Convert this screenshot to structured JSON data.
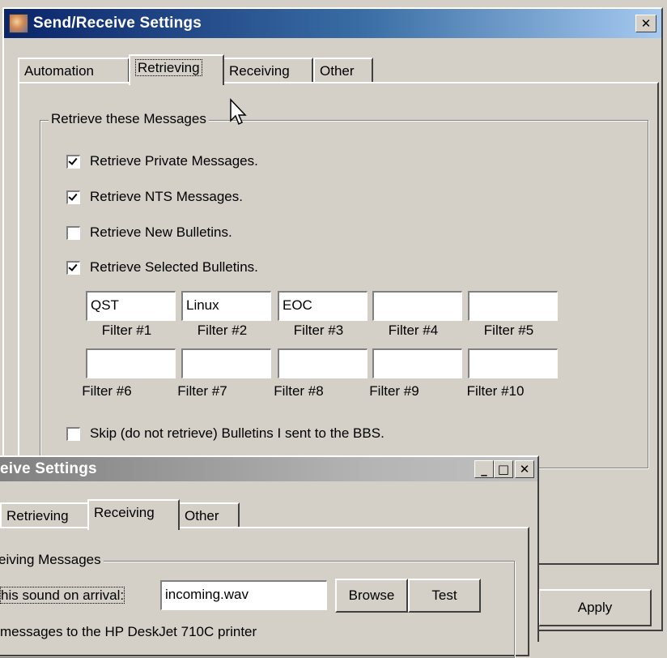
{
  "main": {
    "title": "Send/Receive Settings",
    "close_glyph": "✕",
    "tabs": [
      "Automation",
      "Retrieving",
      "Receiving",
      "Other"
    ],
    "active_tab": "Retrieving",
    "group_title": "Retrieve these Messages",
    "checkboxes": [
      {
        "label": "Retrieve Private Messages.",
        "checked": true
      },
      {
        "label": "Retrieve NTS Messages.",
        "checked": true
      },
      {
        "label": "Retrieve New Bulletins.",
        "checked": false
      },
      {
        "label": "Retrieve Selected Bulletins.",
        "checked": true
      }
    ],
    "filters": [
      {
        "value": "QST",
        "label": "Filter #1"
      },
      {
        "value": "Linux",
        "label": "Filter #2"
      },
      {
        "value": "EOC",
        "label": "Filter #3"
      },
      {
        "value": "",
        "label": "Filter #4"
      },
      {
        "value": "",
        "label": "Filter #5"
      },
      {
        "value": "",
        "label": "Filter #6"
      },
      {
        "value": "",
        "label": "Filter #7"
      },
      {
        "value": "",
        "label": "Filter #8"
      },
      {
        "value": "",
        "label": "Filter #9"
      },
      {
        "value": "",
        "label": "Filter #10"
      }
    ],
    "skip_checkbox": {
      "label": "Skip (do not retrieve) Bulletins I sent to the BBS.",
      "checked": false
    },
    "apply_label": "Apply"
  },
  "second": {
    "title": "eive Settings",
    "min_glyph": "_",
    "max_glyph": "□",
    "close_glyph": "✕",
    "tabs": [
      "Retrieving",
      "Receiving",
      "Other"
    ],
    "active_tab": "Receiving",
    "group_title": "eiving Messages",
    "sound_label": "his sound on arrival:",
    "sound_value": "incoming.wav",
    "browse_label": "Browse",
    "test_label": "Test",
    "print_label": "messages to the HP DeskJet 710C printer"
  }
}
